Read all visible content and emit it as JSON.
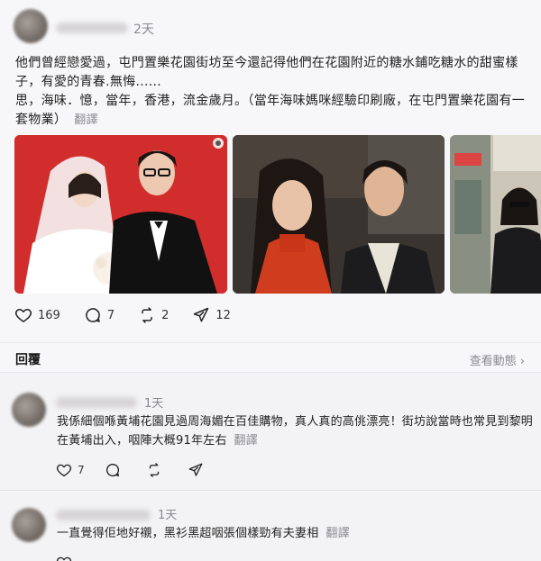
{
  "post": {
    "time": "2天",
    "line1": "他們曾經戀愛過，屯門置樂花園街坊至今還記得他們在花園附近的糖水鋪吃糖水的甜蜜樣子，有愛的青春.無悔......",
    "line2": "思，海味．憶，當年，香港，流金歲月。（當年海味媽咪經驗印刷廠，在屯門置樂花園有一套物業）",
    "translate": "翻譯",
    "likes": "169",
    "comments": "7",
    "reposts": "2",
    "shares": "12"
  },
  "reply_bar": {
    "title": "回覆",
    "view_activity": "查看動態 ›"
  },
  "comments": [
    {
      "time": "1天",
      "text": "我係細個喺黃埔花園見過周海媚在百佳購物，真人真的高佻漂亮！街坊說當時也常見到黎明在黃埔出入，咽陣大概91年左右",
      "translate": "翻譯",
      "likes": "7"
    },
    {
      "time": "1天",
      "text": "一直覺得佢地好襯，黑衫黑超咽張個樣勁有夫妻相",
      "translate": "翻譯"
    }
  ],
  "icons": {
    "heart": "heart-icon",
    "comment": "comment-icon",
    "repost": "repost-icon",
    "share": "share-icon"
  },
  "colors": {
    "muted": "#8a8a8f",
    "text": "#1a1a1a",
    "background": "#f3f3f5"
  }
}
